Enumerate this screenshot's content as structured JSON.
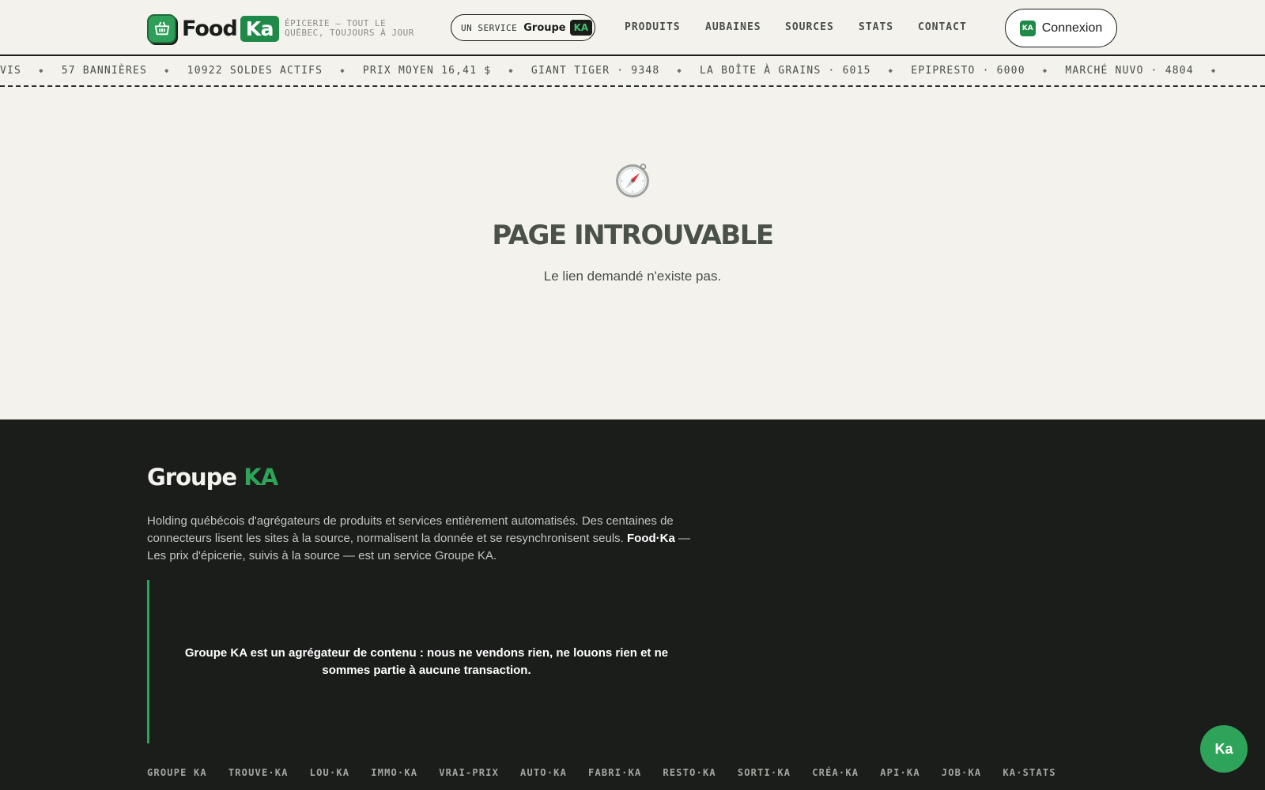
{
  "header": {
    "logo_food": "Food",
    "logo_ka": "Ka",
    "tagline_line1": "ÉPICERIE — TOUT LE",
    "tagline_line2": "QUÉBEC, TOUJOURS À JOUR",
    "service_pre": "UN SERVICE",
    "service_groupe": "Groupe",
    "service_ka": "KA",
    "nav": {
      "produits": "PRODUITS",
      "aubaines": "AUBAINES",
      "sources": "SOURCES",
      "stats": "STATS",
      "contact": "CONTACT"
    },
    "connexion_badge": "KA",
    "connexion_label": "Connexion"
  },
  "ticker": [
    "VIS",
    "57 BANNIÈRES",
    "10922 SOLDES ACTIFS",
    "PRIX MOYEN 16,41 $",
    "GIANT TIGER · 9348",
    "LA BOÎTE À GRAINS · 6015",
    "EPIPRESTO · 6000",
    "MARCHÉ NUVO · 4804"
  ],
  "main": {
    "title": "PAGE INTROUVABLE",
    "subtitle": "Le lien demandé n'existe pas."
  },
  "footer": {
    "brand_groupe": "Groupe",
    "brand_ka": "KA",
    "desc_part1": "Holding québécois d'agrégateurs de produits et services entièrement automatisés. Des centaines de connecteurs lisent les sites à la source, normalisent la donnée et se resynchronisent seuls.",
    "desc_bold": "Food·Ka",
    "desc_part2": "— Les prix d'épicerie, suivis à la source — est un service Groupe KA.",
    "quote": "Groupe KA est un agrégateur de contenu : nous ne vendons rien, ne louons rien et ne sommes partie à aucune transaction.",
    "links": [
      "GROUPE KA",
      "TROUVE·KA",
      "LOU·KA",
      "IMMO·KA",
      "VRAI-PRIX",
      "AUTO·KA",
      "FABRI·KA",
      "RESTO·KA",
      "SORTI·KA",
      "CRÉA·KA",
      "API·KA",
      "JOB·KA",
      "KA·STATS"
    ]
  },
  "fab_label": "Ka",
  "icons": {
    "logo": "basket-icon",
    "main": "compass-icon",
    "ticker_separator": "diamond-icon"
  },
  "colors": {
    "accent": "#1f8a47",
    "accent_light": "#2ea35a",
    "background": "#f3f2ed",
    "footer_background": "#1a1d1a"
  }
}
